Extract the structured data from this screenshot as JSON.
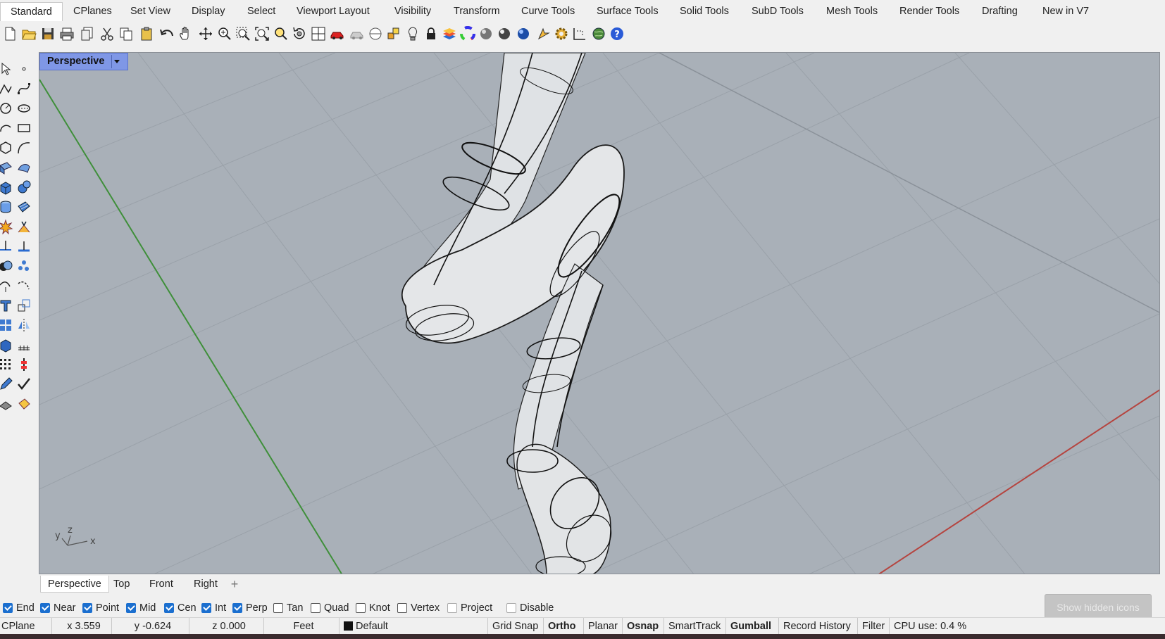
{
  "tabs": [
    "Standard",
    "CPlanes",
    "Set View",
    "Display",
    "Select",
    "Viewport Layout",
    "Visibility",
    "Transform",
    "Curve Tools",
    "Surface Tools",
    "Solid Tools",
    "SubD Tools",
    "Mesh Tools",
    "Render Tools",
    "Drafting",
    "New in V7"
  ],
  "toolbar_icons": [
    "new-icon",
    "open-icon",
    "save-icon",
    "print-icon",
    "import-icon",
    "cut-icon",
    "copy-icon",
    "paste-icon",
    "undo-icon",
    "pan-hand-icon",
    "move-view-icon",
    "zoom-icon",
    "zoom-window-icon",
    "zoom-extents-icon",
    "zoom-selected-icon",
    "rotate-view-icon",
    "four-views-icon",
    "car-icon",
    "car-gray-icon",
    "cplane-icon",
    "snap-icon",
    "light-icon",
    "lock-icon",
    "layer-icon",
    "color-wheel-icon",
    "sphere-shaded-icon",
    "sphere-rendered-icon",
    "sphere-blue-icon",
    "render-icon",
    "settings-gear-icon",
    "dimension-icon",
    "globe-icon",
    "help-icon"
  ],
  "left_icons": [
    "select-arrow-icon",
    "point-icon",
    "polyline-icon",
    "curve-icon",
    "circle-icon",
    "ellipse-icon",
    "arc-icon",
    "rectangle-icon",
    "polygon-icon",
    "free-curve-icon",
    "surface-edit-icon",
    "surface-loft-icon",
    "box-solid-icon",
    "sphere-solid-icon",
    "cylinder-icon",
    "patch-icon",
    "explode-icon",
    "fillet-icon",
    "trim-icon",
    "split-icon",
    "boolean-icon",
    "points-icon",
    "curve-offset-icon",
    "curve-blend-icon",
    "extrude-icon",
    "scale-icon",
    "array-icon",
    "mirror-icon",
    "block-icon",
    "grid-icon",
    "dots-grid-icon",
    "ortho-icon",
    "edit-icon",
    "check-icon",
    "stack-icon",
    "bucket-icon"
  ],
  "viewport": {
    "title": "Perspective",
    "axis_y": "y",
    "axis_z": "z",
    "axis_x": "x"
  },
  "view_tabs": [
    "Perspective",
    "Top",
    "Front",
    "Right"
  ],
  "view_tab_add": "+",
  "osnaps": [
    {
      "label": "End",
      "checked": true
    },
    {
      "label": "Near",
      "checked": true
    },
    {
      "label": "Point",
      "checked": true
    },
    {
      "label": "Mid",
      "checked": true
    },
    {
      "label": "Cen",
      "checked": true
    },
    {
      "label": "Int",
      "checked": true
    },
    {
      "label": "Perp",
      "checked": true
    },
    {
      "label": "Tan",
      "checked": false
    },
    {
      "label": "Quad",
      "checked": false
    },
    {
      "label": "Knot",
      "checked": false
    },
    {
      "label": "Vertex",
      "checked": false
    },
    {
      "label": "Project",
      "checked": false
    },
    {
      "label": "Disable",
      "checked": false
    }
  ],
  "show_hidden_icons": "Show hidden icons",
  "status": {
    "cplane": "CPlane",
    "x": "x 3.559",
    "y": "y -0.624",
    "z": "z 0.000",
    "units": "Feet",
    "layer": "Default",
    "layer_color": "#111111",
    "grid_snap": "Grid Snap",
    "ortho": "Ortho",
    "planar": "Planar",
    "osnap": "Osnap",
    "smarttrack": "SmartTrack",
    "gumball": "Gumball",
    "record_history": "Record History",
    "filter": "Filter",
    "cpu": "CPU use: 0.4 %"
  },
  "colors": {
    "viewport_bg": "#a9b0b8",
    "label_bg": "#7f97e6",
    "y_axis": "#3f8f3a",
    "x_axis": "#b5443f",
    "check": "#1b6fcf"
  }
}
